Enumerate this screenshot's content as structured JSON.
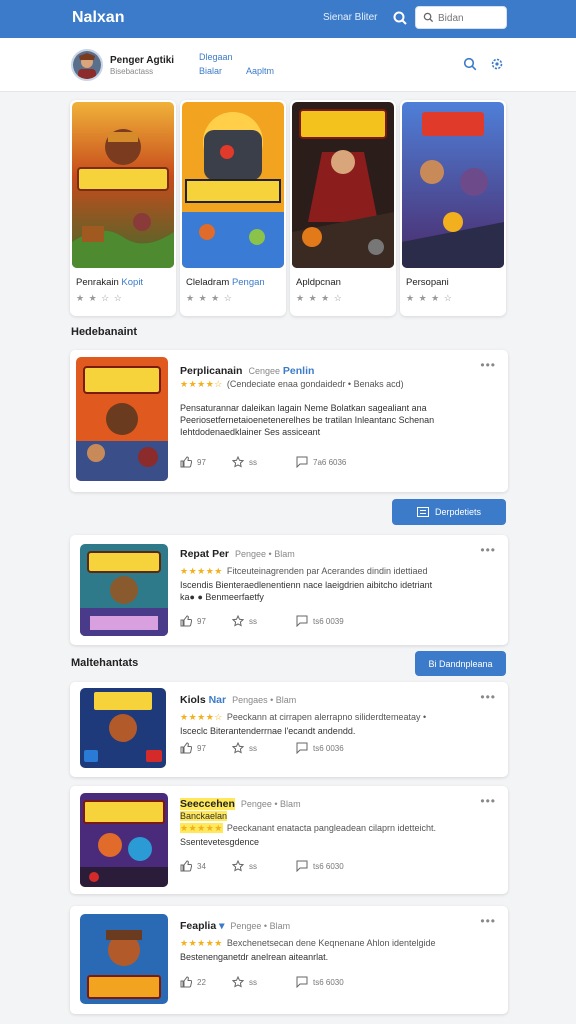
{
  "appbar": {
    "brand": "Nalxan",
    "link": "Sienar Bliter",
    "search_placeholder": "Bidan"
  },
  "user": {
    "name": "Penger Agtiki",
    "sub": "Bisebactass",
    "link_top": "Dlegaan",
    "link_a": "Bialar",
    "link_b": "Aapltm"
  },
  "featured": [
    {
      "title": "Penrakain",
      "tag": "Kopit",
      "stars": "★ ★ ☆ ☆"
    },
    {
      "title": "Cleladram",
      "tag": "Pengan",
      "stars": "★ ★ ★ ☆"
    },
    {
      "title": "Apldpcnan",
      "tag": "",
      "stars": "★ ★ ★ ☆"
    },
    {
      "title": "Persopani",
      "tag": "",
      "stars": "★ ★ ★ ☆"
    }
  ],
  "section1": {
    "title": "Hedebanaint"
  },
  "section2": {
    "title": "Maltehantats",
    "button": "Bi Dandnpleana"
  },
  "view_button": "Derpdetiets",
  "cards": [
    {
      "title": "Perplicanain",
      "meta": "Cengee",
      "accent": "Penlin",
      "stars": "★★★★☆",
      "stars_rest": "(Cendeciate enaa gondaidedr • Benaks acd)",
      "desc": "Pensaturannar daleikan lagain Neme Bolatkan sagealiant ana Peeriosetfernetaioenetenerelhes be tratilan Inleantanc Schenan Iehtdodenaedklainer Ses assiceant",
      "likes": "97",
      "shares": "ss",
      "comments": "7a6 6036"
    },
    {
      "title": "Repat Per",
      "meta": "Pengee • Blam",
      "accent": "",
      "stars": "★★★★★",
      "stars_rest": "Fitceuteinagrenden par Acerandes dindin idettiaed",
      "desc": "Iscendis Bienteraedlenentienn nace laeigdrien aibitcho idetriant",
      "highlight": "",
      "extra": "ka● ● Benmeerfaetfy",
      "likes": "97",
      "shares": "ss",
      "comments": "ts6 0039"
    },
    {
      "title": "Kiols",
      "meta": "Pengaes • Blam",
      "accent": "Nar",
      "stars": "★★★★☆",
      "stars_rest": "Peeckann at cirrapen alerrapno siliderdtemeatay •",
      "desc": "Isceclc Biterantenderrnae l'ecandt andendd.",
      "likes": "97",
      "shares": "ss",
      "comments": "ts6 0036"
    },
    {
      "title": "Seeccehen",
      "meta": "Pengee • Blam",
      "accent": "",
      "highlight": "Banckaelan",
      "stars": "★★★★★",
      "stars_rest": "Peeckanant enatacta pangleadean cilaprn idetteicht.",
      "desc": "Ssentevetesgdence",
      "likes": "34",
      "shares": "ss",
      "comments": "ts6 6030"
    },
    {
      "title": "Feaplia",
      "meta": "Pengee • Blam",
      "accent": "▾",
      "stars": "★★★★★",
      "stars_rest": "Bexchenetsecan dene Keqnenane Ahlon identelgide",
      "desc": "Bestenenganetdr anelrean aiteanrlat.",
      "likes": "22",
      "shares": "ss",
      "comments": "ts6 6030"
    }
  ],
  "colors": {
    "primary": "#3b7bc9",
    "star": "#f2b01e",
    "highlight": "#ffe85a"
  }
}
